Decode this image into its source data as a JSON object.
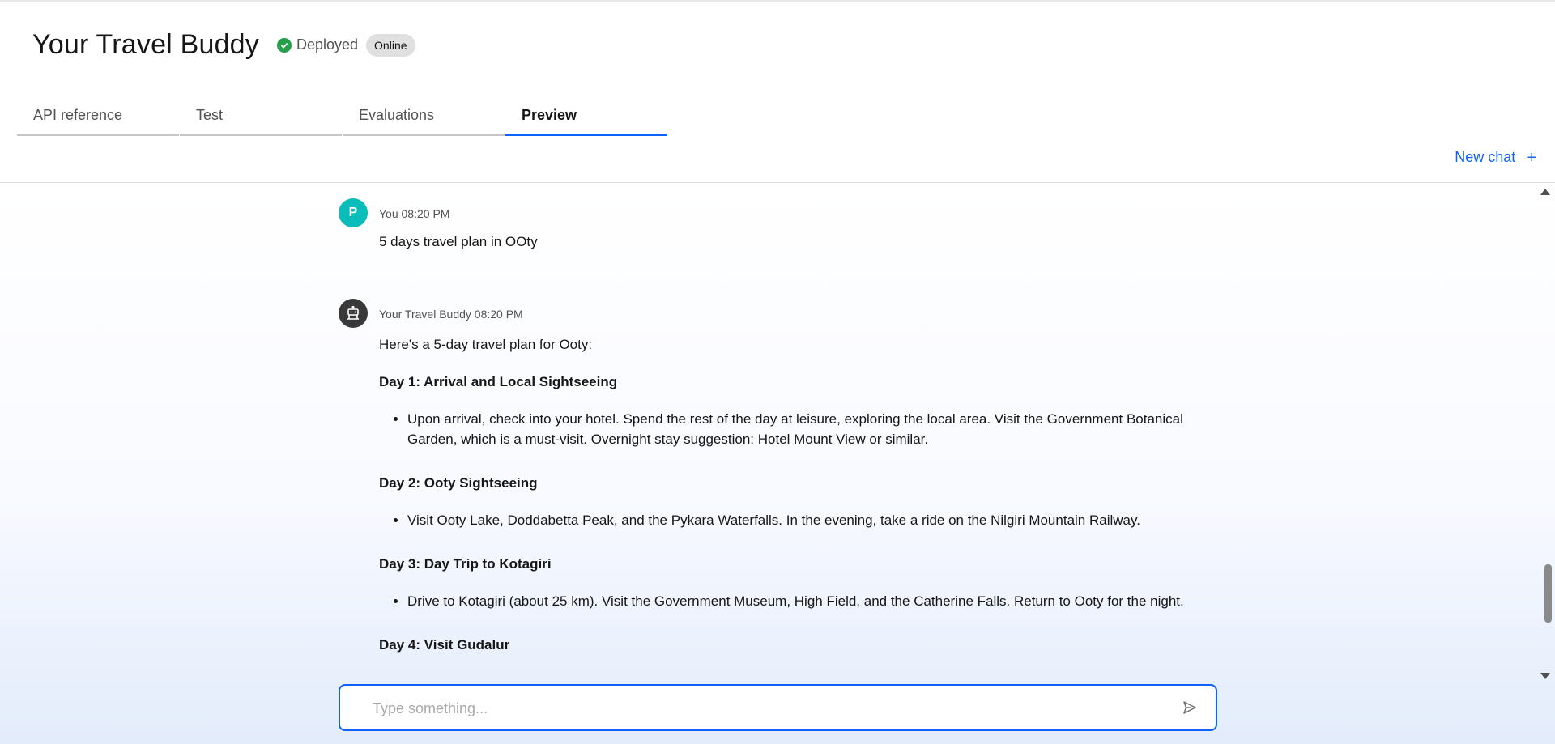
{
  "app": {
    "title": "Your Travel Buddy",
    "status": "Deployed",
    "badge": "Online"
  },
  "tabs": [
    {
      "label": "API reference",
      "active": false
    },
    {
      "label": "Test",
      "active": false
    },
    {
      "label": "Evaluations",
      "active": false
    },
    {
      "label": "Preview",
      "active": true
    }
  ],
  "new_chat": {
    "label": "New chat",
    "icon": "plus-icon"
  },
  "messages": [
    {
      "sender": "You",
      "time": "08:20 PM",
      "avatar": "P",
      "text": "5 days travel plan in OOty"
    },
    {
      "sender": "Your Travel Buddy",
      "time": "08:20 PM",
      "avatar_icon": "robot-icon",
      "intro": "Here's a 5-day travel plan for Ooty:",
      "days": [
        {
          "title": "Day 1: Arrival and Local Sightseeing",
          "bullet": "Upon arrival, check into your hotel. Spend the rest of the day at leisure, exploring the local area. Visit the Government Botanical Garden, which is a must-visit. Overnight stay suggestion: Hotel Mount View or similar."
        },
        {
          "title": "Day 2: Ooty Sightseeing",
          "bullet": "Visit Ooty Lake, Doddabetta Peak, and the Pykara Waterfalls. In the evening, take a ride on the Nilgiri Mountain Railway."
        },
        {
          "title": "Day 3: Day Trip to Kotagiri",
          "bullet": "Drive to Kotagiri (about 25 km). Visit the Government Museum, High Field, and the Catherine Falls. Return to Ooty for the night."
        },
        {
          "title": "Day 4: Visit Gudalur",
          "bullet": ""
        }
      ]
    }
  ],
  "input": {
    "placeholder": "Type something...",
    "value": ""
  },
  "colors": {
    "accent": "#0f62fe",
    "status_green": "#24a148",
    "user_avatar": "#08bdba",
    "bot_avatar": "#393939"
  }
}
